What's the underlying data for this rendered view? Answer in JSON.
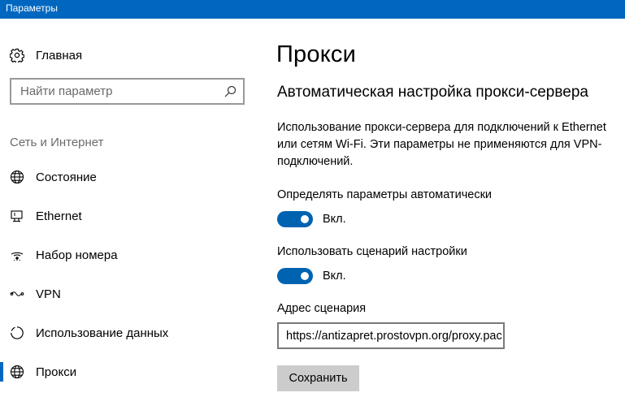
{
  "window": {
    "title": "Параметры"
  },
  "sidebar": {
    "home_label": "Главная",
    "search_placeholder": "Найти параметр",
    "section_label": "Сеть и Интернет",
    "items": [
      {
        "label": "Состояние",
        "icon": "globe-icon"
      },
      {
        "label": "Ethernet",
        "icon": "ethernet-icon"
      },
      {
        "label": "Набор номера",
        "icon": "dialup-icon"
      },
      {
        "label": "VPN",
        "icon": "vpn-icon"
      },
      {
        "label": "Использование данных",
        "icon": "data-usage-icon"
      },
      {
        "label": "Прокси",
        "icon": "globe-icon",
        "active": true
      }
    ]
  },
  "main": {
    "page_title": "Прокси",
    "section_title": "Автоматическая настройка прокси-сервера",
    "description": "Использование прокси-сервера для подключений к Ethernet или сетям Wi-Fi. Эти параметры не применяются для VPN-подключений.",
    "auto_detect": {
      "label": "Определять параметры автоматически",
      "state_text": "Вкл.",
      "on": true
    },
    "use_script": {
      "label": "Использовать сценарий настройки",
      "state_text": "Вкл.",
      "on": true
    },
    "script_address": {
      "label": "Адрес сценария",
      "value": "https://antizapret.prostovpn.org/proxy.pac"
    },
    "save_label": "Сохранить"
  },
  "colors": {
    "accent": "#0067c0",
    "toggle_on": "#0063b1",
    "button_bg": "#cccccc"
  }
}
